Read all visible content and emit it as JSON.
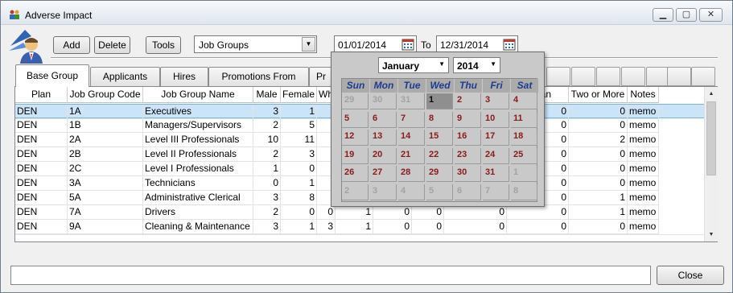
{
  "window": {
    "title": "Adverse Impact"
  },
  "toolbar": {
    "add_label": "Add",
    "delete_label": "Delete",
    "tools_label": "Tools",
    "group_select_value": "Job Groups",
    "date_from": "01/01/2014",
    "to_label": "To",
    "date_to": "12/31/2014"
  },
  "tabs": [
    "Base Group",
    "Applicants",
    "Hires",
    "Promotions From",
    "Pr"
  ],
  "grid": {
    "headers": [
      "Plan",
      "Job Group Code",
      "Job Group Name",
      "Male",
      "Female",
      "Wh",
      "",
      "",
      "",
      "",
      "waiian",
      "Two or More",
      "Notes"
    ],
    "rows": [
      [
        "DEN",
        "1A",
        "Executives",
        "3",
        "1",
        "",
        "",
        "",
        "",
        "",
        "0",
        "0",
        "memo"
      ],
      [
        "DEN",
        "1B",
        "Managers/Supervisors",
        "2",
        "5",
        "",
        "",
        "",
        "",
        "",
        "0",
        "0",
        "memo"
      ],
      [
        "DEN",
        "2A",
        "Level III Professionals",
        "10",
        "11",
        "",
        "",
        "",
        "",
        "",
        "0",
        "2",
        "memo"
      ],
      [
        "DEN",
        "2B",
        "Level II Professionals",
        "2",
        "3",
        "",
        "",
        "",
        "",
        "",
        "0",
        "0",
        "memo"
      ],
      [
        "DEN",
        "2C",
        "Level I Professionals",
        "1",
        "0",
        "",
        "",
        "",
        "",
        "",
        "0",
        "0",
        "memo"
      ],
      [
        "DEN",
        "3A",
        "Technicians",
        "0",
        "1",
        "",
        "",
        "",
        "",
        "",
        "0",
        "0",
        "memo"
      ],
      [
        "DEN",
        "5A",
        "Administrative Clerical",
        "3",
        "8",
        "",
        "",
        "",
        "",
        "",
        "0",
        "1",
        "memo"
      ],
      [
        "DEN",
        "7A",
        "Drivers",
        "2",
        "0",
        "0",
        "1",
        "0",
        "0",
        "0",
        "0",
        "1",
        "memo"
      ],
      [
        "DEN",
        "9A",
        "Cleaning & Maintenance",
        "3",
        "1",
        "3",
        "1",
        "0",
        "0",
        "0",
        "0",
        "0",
        "memo"
      ]
    ]
  },
  "calendar": {
    "month": "January",
    "year": "2014",
    "weekdays": [
      "Sun",
      "Mon",
      "Tue",
      "Wed",
      "Thu",
      "Fri",
      "Sat"
    ],
    "weeks": [
      [
        "29",
        "30",
        "31",
        "1",
        "2",
        "3",
        "4"
      ],
      [
        "5",
        "6",
        "7",
        "8",
        "9",
        "10",
        "11"
      ],
      [
        "12",
        "13",
        "14",
        "15",
        "16",
        "17",
        "18"
      ],
      [
        "19",
        "20",
        "21",
        "22",
        "23",
        "24",
        "25"
      ],
      [
        "26",
        "27",
        "28",
        "29",
        "30",
        "31",
        "1"
      ],
      [
        "2",
        "3",
        "4",
        "5",
        "6",
        "7",
        "8"
      ]
    ],
    "selected_day": "1"
  },
  "footer": {
    "close_label": "Close",
    "status_text": ""
  }
}
